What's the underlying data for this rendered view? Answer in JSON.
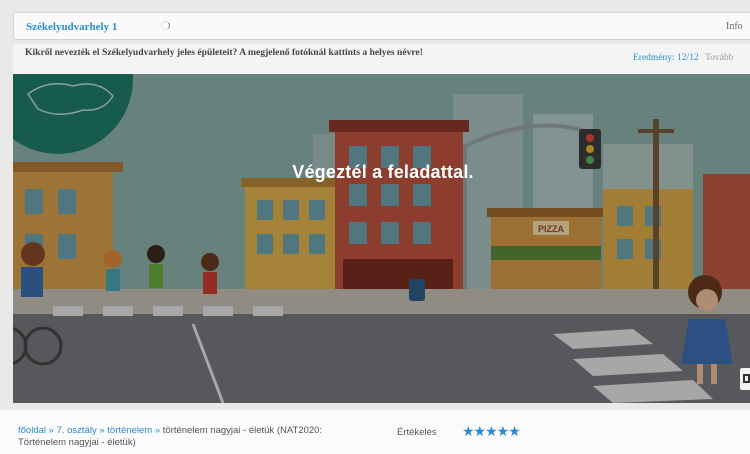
{
  "header": {
    "title": "Székelyudvarhely 1",
    "info_label": "Info"
  },
  "question": {
    "text": "Kikről nevezték el Székelyudvarhely jeles épületeit? A megjelenő fotóknál kattints a helyes névre!",
    "score": "Eredmény: 12/12",
    "next_label": "Tovább"
  },
  "stage": {
    "message": "Végeztél a feladattal.",
    "shop_sign": "PIZZA"
  },
  "footer": {
    "breadcrumb": {
      "home": "főoldal",
      "separator": "»",
      "grade": "7. osztály",
      "subject": "történelem",
      "current": "történelem nagyjai - életük (NAT2020: Történelem nagyjai - életük)"
    },
    "rating_label": "Értékelés",
    "rating_stars": "★★★★★",
    "rating_value": 5
  },
  "colors": {
    "accent": "#2a8ccf",
    "map_badge": "#1f7f6b"
  }
}
